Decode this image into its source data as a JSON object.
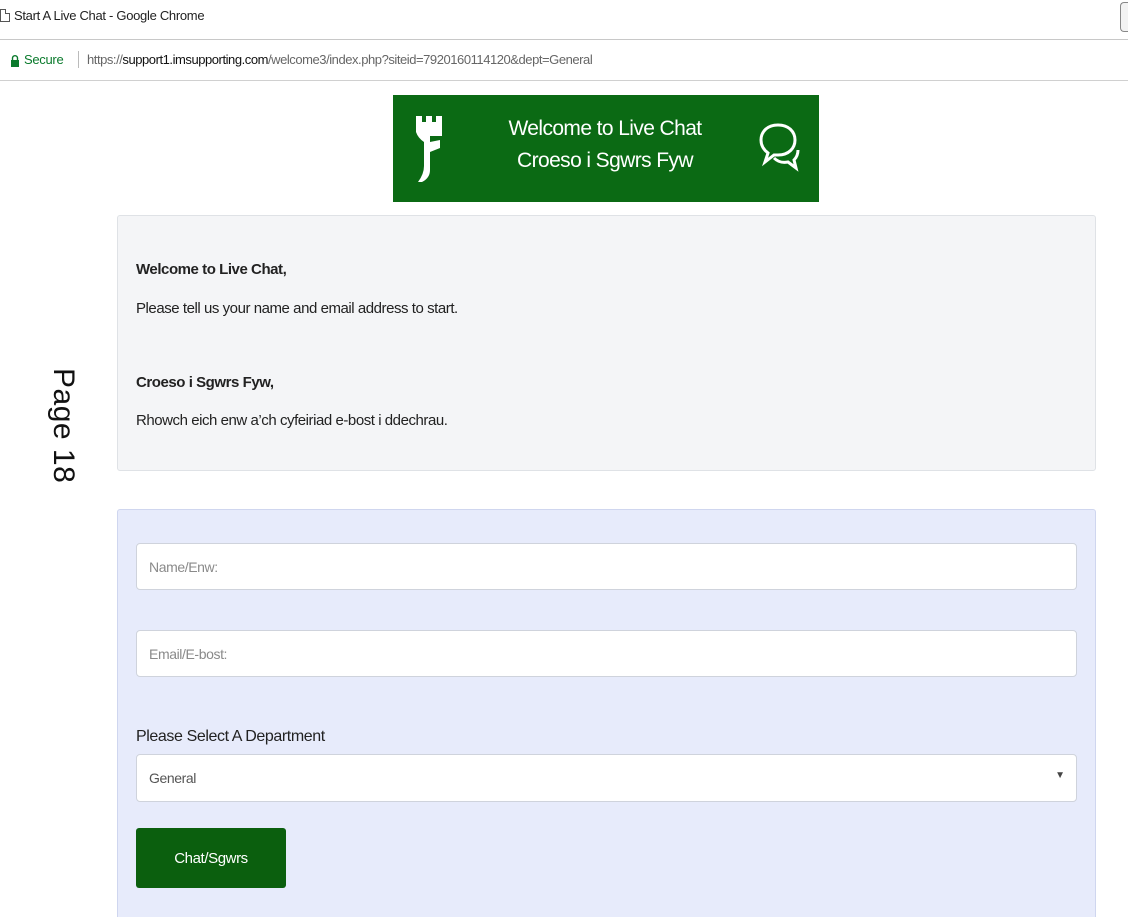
{
  "window": {
    "title": "Start A Live Chat - Google Chrome"
  },
  "addressbar": {
    "secure_label": "Secure",
    "url_scheme": "https://",
    "url_host": "support1.imsupporting.com",
    "url_path": "/welcome3/index.php?siteid=7920160114120&dept=General"
  },
  "banner": {
    "line1": "Welcome to Live Chat",
    "line2": "Croeso i Sgwrs Fyw",
    "bg_color": "#0b6a14"
  },
  "page_label": "Page 18",
  "welcome": {
    "heading_en": "Welcome to Live Chat,",
    "text_en": "Please tell us your name and email address to start.",
    "heading_cy": "Croeso i Sgwrs Fyw,",
    "text_cy": "Rhowch eich enw a’ch cyfeiriad e-bost i ddechrau."
  },
  "form": {
    "name_placeholder": "Name/Enw:",
    "email_placeholder": "Email/E-bost:",
    "department_label": "Please Select A Department",
    "department_selected": "General",
    "submit_label": "Chat/Sgwrs",
    "submit_color": "#0b5f0e"
  },
  "icons": {
    "logo": "castle-logo-icon",
    "chat": "chat-bubbles-icon",
    "lock": "lock-icon",
    "page": "page-icon"
  }
}
